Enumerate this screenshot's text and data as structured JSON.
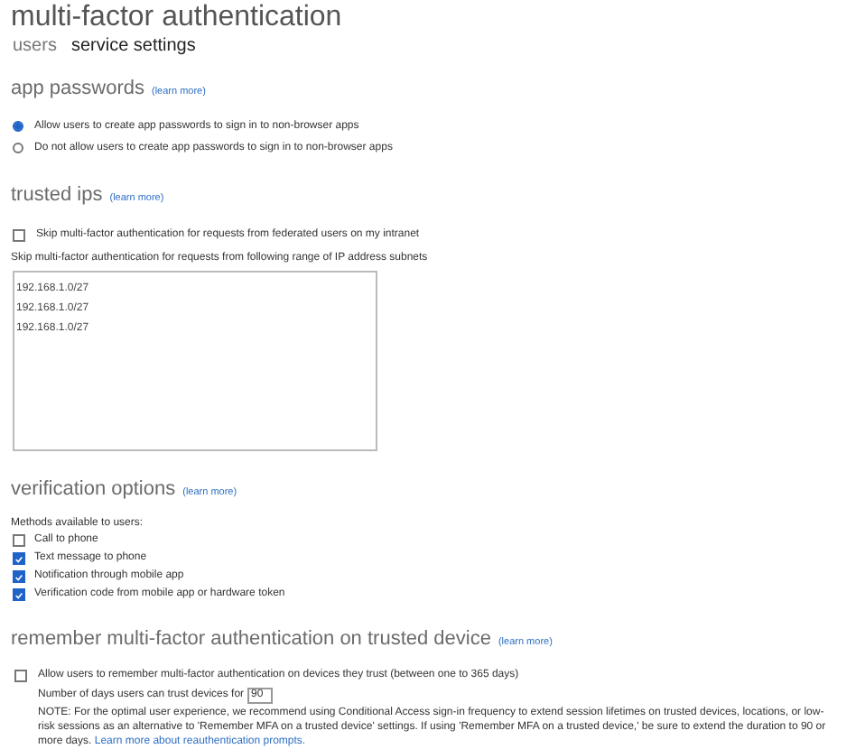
{
  "title": "multi-factor authentication",
  "tabs": [
    {
      "label": "users",
      "selected": false
    },
    {
      "label": "service settings",
      "selected": true
    }
  ],
  "app_passwords": {
    "heading": "app passwords",
    "link": "(learn more)",
    "options": [
      {
        "label": "Allow users to create app passwords to sign in to non-browser apps",
        "selected": true
      },
      {
        "label": "Do not allow users to create app passwords to sign in to non-browser apps",
        "selected": false
      }
    ]
  },
  "trusted_ips": {
    "heading": "trusted ips",
    "link": "(learn more)",
    "skip_federated": {
      "label": "Skip multi-factor authentication for requests from federated users on my intranet",
      "checked": false
    },
    "subnets_label": "Skip multi-factor authentication for requests from following range of IP address subnets",
    "subnets": [
      "192.168.1.0/27",
      "192.168.1.0/27",
      "192.168.1.0/27"
    ]
  },
  "verification_options": {
    "heading": "verification options",
    "link": "(learn more)",
    "methods_label": "Methods available to users:",
    "methods": [
      {
        "label": "Call to phone",
        "checked": false
      },
      {
        "label": "Text message to phone",
        "checked": true
      },
      {
        "label": "Notification through mobile app",
        "checked": true
      },
      {
        "label": "Verification code from mobile app or hardware token",
        "checked": true
      }
    ]
  },
  "remember_device": {
    "heading": "remember multi-factor authentication on trusted device",
    "link": "(learn more)",
    "allow": {
      "label": "Allow users to remember multi-factor authentication on devices they trust (between one to 365 days)",
      "checked": false
    },
    "days_label": "Number of days users can trust devices for",
    "days_value": "90",
    "note": "NOTE: For the optimal user experience, we recommend using Conditional Access sign-in frequency to extend session lifetimes on trusted devices, locations, or low-risk sessions as an alternative to 'Remember MFA on a trusted device' settings. If using 'Remember MFA on a trusted device,' be sure to extend the duration to 90 or more days.",
    "note_link": "Learn more about reauthentication prompts."
  }
}
